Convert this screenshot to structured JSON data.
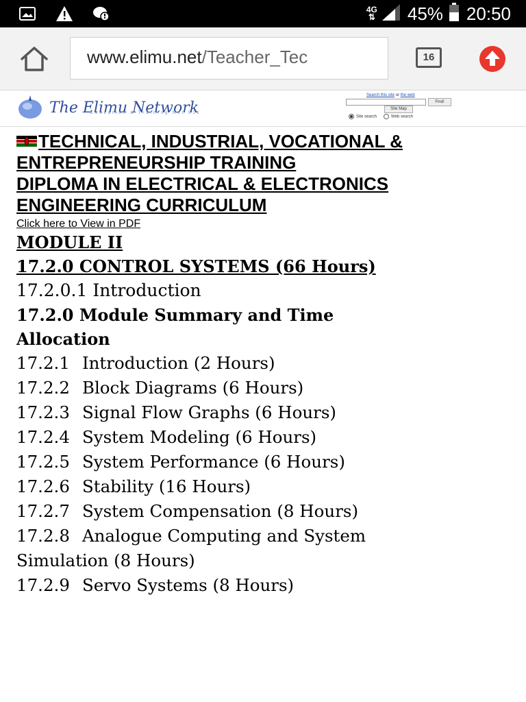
{
  "status_bar": {
    "network_type": "4G",
    "battery_percent": "45%",
    "time": "20:50"
  },
  "browser": {
    "url_host": "www.elimu.net",
    "url_path": "/Teacher_Tec",
    "tab_count": "16"
  },
  "site_header": {
    "logo_title": "The Elimu Network",
    "logo_tagline": "Education & Training Net 911",
    "search": {
      "link_site": "Search this site",
      "link_or": "or",
      "link_web": "the web",
      "find_label": "Find!",
      "sitemap_label": "Site Map",
      "radio_site": "Site search",
      "radio_web": "Web search"
    }
  },
  "content": {
    "heading_lines": [
      "TECHNICAL, INDUSTRIAL, VOCATIONAL &",
      "ENTREPRENEURSHIP TRAINING",
      "DIPLOMA IN ELECTRICAL & ELECTRONICS",
      "ENGINEERING CURRICULUM"
    ],
    "pdf_link": "Click here to View  in PDF",
    "module_title": "MODULE II",
    "unit_title": "17.2.0 CONTROL SYSTEMS (66 Hours)",
    "intro": "17.2.0.1 Introduction",
    "summary_line1": "17.2.0 Module Summary and Time",
    "summary_line2": "Allocation",
    "topics": [
      {
        "num": "17.2.1",
        "title": "Introduction (2 Hours)"
      },
      {
        "num": "17.2.2",
        "title": "Block Diagrams (6 Hours)"
      },
      {
        "num": "17.2.3",
        "title": "Signal Flow Graphs (6 Hours)"
      },
      {
        "num": "17.2.4",
        "title": "System Modeling (6 Hours)"
      },
      {
        "num": "17.2.5",
        "title": "System Performance (6 Hours)"
      },
      {
        "num": "17.2.6",
        "title": "Stability (16 Hours)"
      },
      {
        "num": "17.2.7",
        "title": "System Compensation (8 Hours)"
      },
      {
        "num": "17.2.8",
        "title": "Analogue Computing and System"
      },
      {
        "num": "",
        "title": "Simulation (8 Hours)"
      },
      {
        "num": "17.2.9",
        "title": "Servo Systems (8 Hours)"
      }
    ]
  }
}
